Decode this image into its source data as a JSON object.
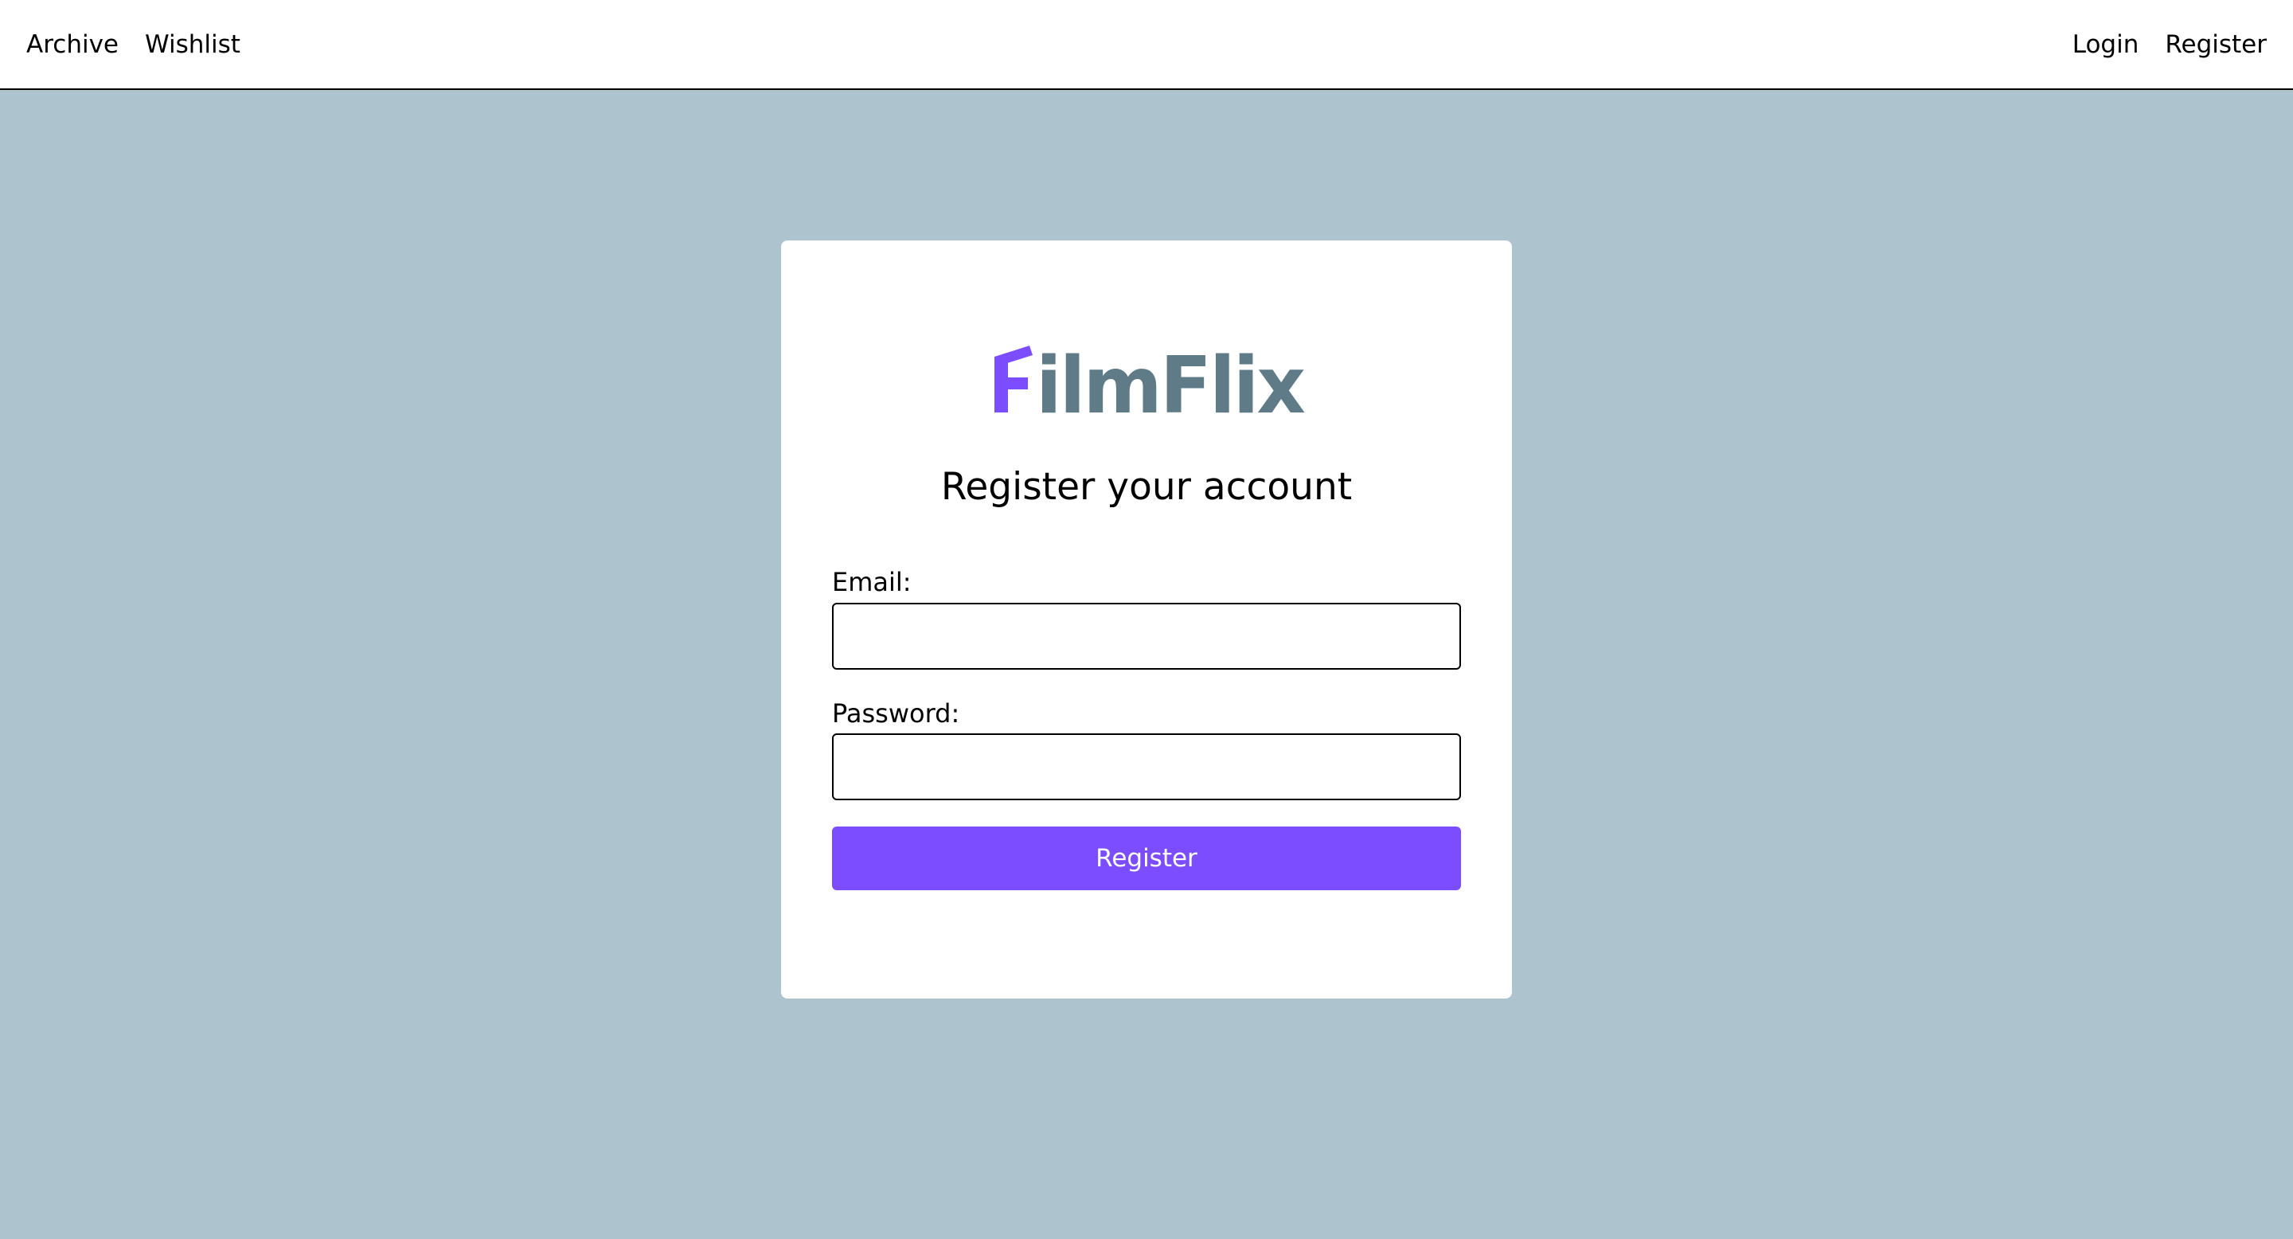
{
  "nav": {
    "left": [
      "Archive",
      "Wishlist"
    ],
    "right": [
      "Login",
      "Register"
    ]
  },
  "logo": {
    "text": "FilmFlix",
    "accent_color": "#7b4dff",
    "text_color": "#5f7b88"
  },
  "form": {
    "title": "Register your account",
    "email_label": "Email:",
    "email_value": "",
    "password_label": "Password:",
    "password_value": "",
    "submit_label": "Register"
  },
  "colors": {
    "background": "#adc4cf",
    "card": "#ffffff",
    "button": "#7b4dff"
  }
}
